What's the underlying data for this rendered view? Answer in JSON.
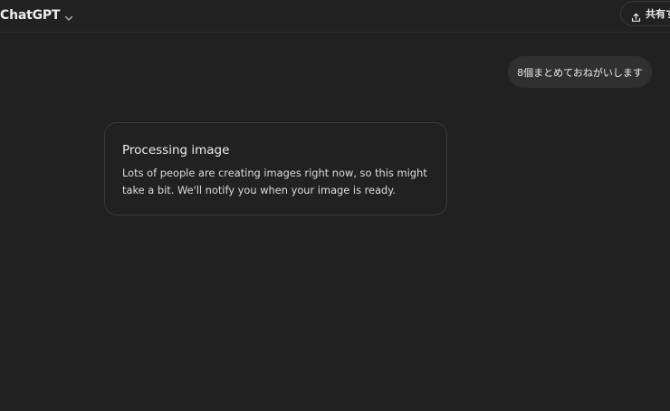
{
  "header": {
    "model_name": "ChatGPT",
    "share_label": "共有する"
  },
  "icons": {
    "model_chevron": "chevron-down-icon",
    "share": "share-upload-icon"
  },
  "conversation": {
    "user_message": "8個まとめておねがいします",
    "processing": {
      "title": "Processing image",
      "body": "Lots of people are creating images right now, so this might take a bit. We'll notify you when your image is ready."
    }
  },
  "colors": {
    "background": "#212121",
    "bubble": "#303030",
    "border": "#3b3b3b",
    "text": "#ececec"
  }
}
